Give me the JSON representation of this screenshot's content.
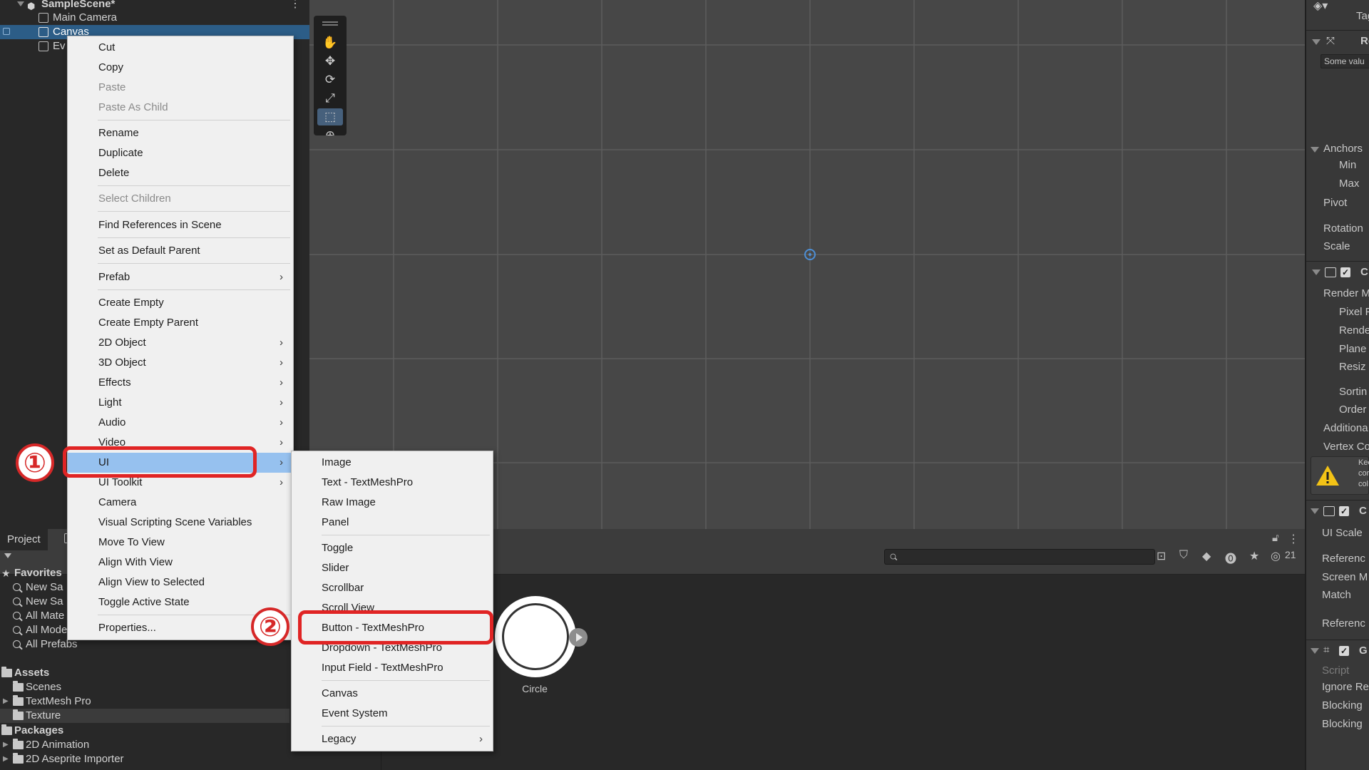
{
  "hierarchy": {
    "scene_name": "SampleScene*",
    "items": [
      {
        "label": "Main Camera",
        "selected": false
      },
      {
        "label": "Canvas",
        "selected": true
      },
      {
        "label": "Ev",
        "selected": false
      }
    ],
    "menu_icon": "kebab-icon"
  },
  "scene_toolbar": {
    "tools": [
      "hand-tool",
      "move-tool",
      "rotate-tool",
      "scale-tool",
      "rect-tool",
      "transform-tool"
    ],
    "active_tool": "rect-tool"
  },
  "context_menu": {
    "items": [
      {
        "label": "Cut",
        "state": "enabled"
      },
      {
        "label": "Copy",
        "state": "enabled"
      },
      {
        "label": "Paste",
        "state": "disabled"
      },
      {
        "label": "Paste As Child",
        "state": "disabled"
      },
      {
        "label": "Rename",
        "state": "enabled"
      },
      {
        "label": "Duplicate",
        "state": "enabled"
      },
      {
        "label": "Delete",
        "state": "enabled"
      },
      {
        "label": "Select Children",
        "state": "disabled"
      },
      {
        "label": "Find References in Scene",
        "state": "enabled"
      },
      {
        "label": "Set as Default Parent",
        "state": "enabled"
      },
      {
        "label": "Prefab",
        "state": "submenu"
      },
      {
        "label": "Create Empty",
        "state": "enabled"
      },
      {
        "label": "Create Empty Parent",
        "state": "enabled"
      },
      {
        "label": "2D Object",
        "state": "submenu"
      },
      {
        "label": "3D Object",
        "state": "submenu"
      },
      {
        "label": "Effects",
        "state": "submenu"
      },
      {
        "label": "Light",
        "state": "submenu"
      },
      {
        "label": "Audio",
        "state": "submenu"
      },
      {
        "label": "Video",
        "state": "submenu"
      },
      {
        "label": "UI",
        "state": "highlighted"
      },
      {
        "label": "UI Toolkit",
        "state": "submenu"
      },
      {
        "label": "Camera",
        "state": "enabled"
      },
      {
        "label": "Visual Scripting Scene Variables",
        "state": "enabled"
      },
      {
        "label": "Move To View",
        "state": "enabled"
      },
      {
        "label": "Align With View",
        "state": "enabled"
      },
      {
        "label": "Align View to Selected",
        "state": "enabled"
      },
      {
        "label": "Toggle Active State",
        "state": "enabled"
      },
      {
        "label": "Properties...",
        "state": "enabled"
      }
    ],
    "submenu_arrow": "›"
  },
  "ui_submenu": {
    "items": [
      {
        "label": "Image"
      },
      {
        "label": "Text - TextMeshPro"
      },
      {
        "label": "Raw Image"
      },
      {
        "label": "Panel"
      },
      {
        "label": "Toggle"
      },
      {
        "label": "Slider"
      },
      {
        "label": "Scrollbar"
      },
      {
        "label": "Scroll View"
      },
      {
        "label": "Button - TextMeshPro"
      },
      {
        "label": "Dropdown - TextMeshPro"
      },
      {
        "label": "Input Field - TextMeshPro"
      },
      {
        "label": "Canvas"
      },
      {
        "label": "Event System"
      },
      {
        "label": "Legacy"
      }
    ]
  },
  "annotations": {
    "step1": "①",
    "step2": "②",
    "highlight_color": "#e02424"
  },
  "project": {
    "tab_label": "Project",
    "favorites_label": "Favorites",
    "favorites": [
      "New Sa",
      "New Sa",
      "All Mate",
      "All Mode",
      "All Prefabs"
    ],
    "assets_label": "Assets",
    "assets": [
      "Scenes",
      "TextMesh Pro",
      "Texture"
    ],
    "packages_label": "Packages",
    "packages": [
      "2D Animation",
      "2D Aseprite Importer"
    ],
    "hidden_count": "21",
    "asset_preview_label": "Circle"
  },
  "inspector": {
    "tag_label": "Tag",
    "rect_header": "Re",
    "some_values": "Some valu",
    "anchors": "Anchors",
    "min": "Min",
    "max": "Max",
    "pivot": "Pivot",
    "rotation": "Rotation",
    "scale": "Scale",
    "canvas_header": "C",
    "render_mode": "Render M",
    "pixel_perfect": "Pixel P",
    "render": "Rende",
    "plane": "Plane",
    "resize": "Resiz",
    "sorting": "Sortin",
    "order": "Order",
    "additional": "Additiona",
    "vertex": "Vertex Co",
    "warning_text": [
      "Kee",
      "cor",
      "col"
    ],
    "scaler_header": "C",
    "ui_scale": "UI Scale",
    "reference1": "Referenc",
    "screen": "Screen M",
    "match": "Match",
    "reference2": "Referenc",
    "raycaster_header": "G",
    "script": "Script",
    "ignore": "Ignore Re",
    "blocking1": "Blocking",
    "blocking2": "Blocking"
  },
  "colors": {
    "menu_highlight": "#96c1ef",
    "selection": "#2c5d87"
  }
}
